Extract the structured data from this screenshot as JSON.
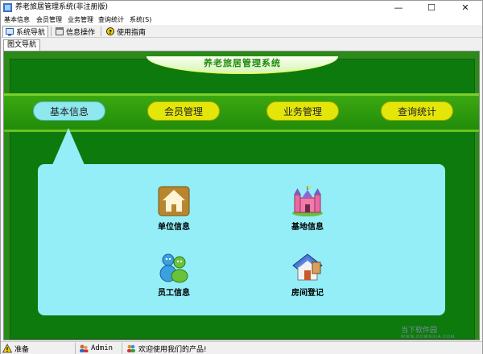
{
  "window": {
    "title": "养老旅居管理系统(非注册版)"
  },
  "window_controls": {
    "minimize": "—",
    "maximize": "☐",
    "close": "✕"
  },
  "menubar": {
    "items": [
      "基本信息",
      "会员管理",
      "业务管理",
      "查询统计",
      "系统(S)"
    ]
  },
  "toolbar": {
    "tabs": [
      "系统导航",
      "信息操作",
      "使用指南"
    ]
  },
  "doc_tab": {
    "label": "图文导航"
  },
  "banner": {
    "title": "养老旅居管理系统"
  },
  "nav": {
    "items": [
      "基本信息",
      "会员管理",
      "业务管理",
      "查询统计"
    ],
    "active_index": 0
  },
  "panel": {
    "items": [
      {
        "label": "单位信息",
        "icon": "house-icon"
      },
      {
        "label": "基地信息",
        "icon": "castle-icon"
      },
      {
        "label": "员工信息",
        "icon": "people-icon"
      },
      {
        "label": "房间登记",
        "icon": "room-icon"
      }
    ]
  },
  "statusbar": {
    "status": "准备",
    "user": "Admin",
    "message": "欢迎使用我们的产品!"
  },
  "watermark": {
    "text": "当下软件园",
    "sub": "WWW.DOWNXIA.COM"
  },
  "colors": {
    "accent_green": "#1f8a10",
    "nav_yellow": "#e4e60a",
    "nav_active": "#8ee8ee",
    "panel_bg": "#93eef7"
  }
}
